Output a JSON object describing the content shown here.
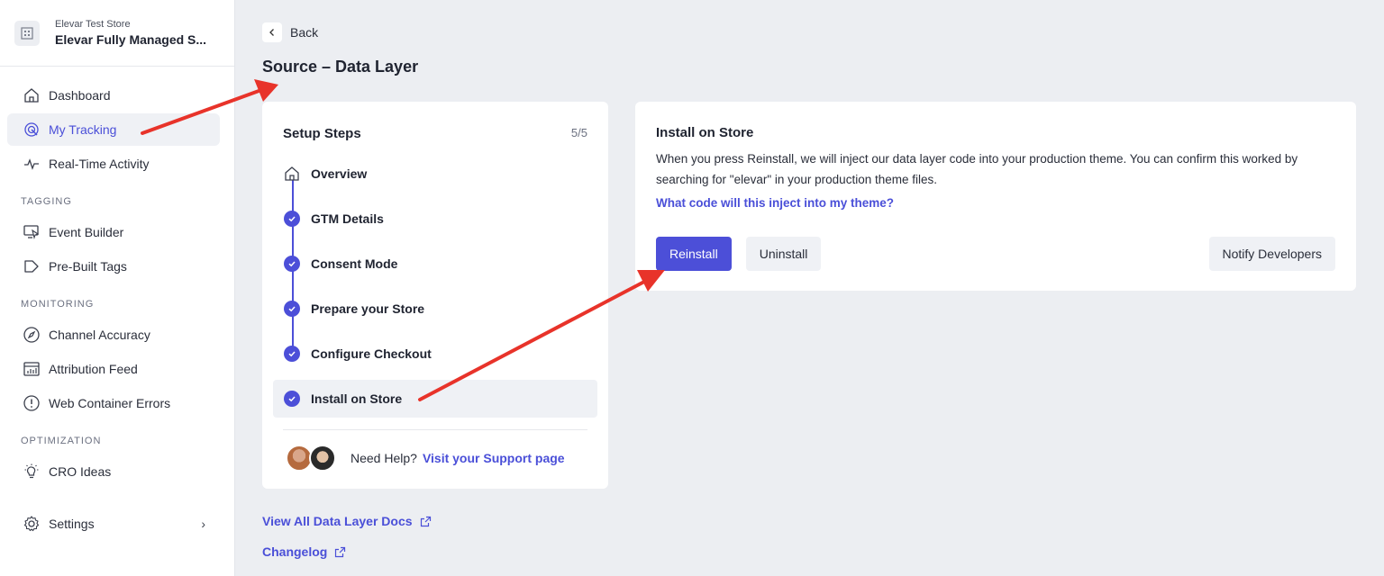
{
  "store": {
    "subtitle": "Elevar Test Store",
    "name": "Elevar Fully Managed S..."
  },
  "sidebar": {
    "top_items": [
      {
        "label": "Dashboard",
        "icon": "home-icon"
      },
      {
        "label": "My Tracking",
        "icon": "target-icon",
        "active": true
      },
      {
        "label": "Real-Time Activity",
        "icon": "pulse-icon"
      }
    ],
    "tagging": {
      "title": "TAGGING",
      "items": [
        {
          "label": "Event Builder",
          "icon": "monitor-cursor-icon"
        },
        {
          "label": "Pre-Built Tags",
          "icon": "tag-icon"
        }
      ]
    },
    "monitoring": {
      "title": "MONITORING",
      "items": [
        {
          "label": "Channel Accuracy",
          "icon": "compass-icon"
        },
        {
          "label": "Attribution Feed",
          "icon": "bar-chart-icon"
        },
        {
          "label": "Web Container Errors",
          "icon": "alert-circle-icon"
        }
      ]
    },
    "optimization": {
      "title": "OPTIMIZATION",
      "items": [
        {
          "label": "CRO Ideas",
          "icon": "lightbulb-icon"
        }
      ]
    },
    "settings": {
      "label": "Settings",
      "icon": "gear-icon"
    }
  },
  "header": {
    "back_label": "Back",
    "title": "Source – Data Layer"
  },
  "steps": {
    "title": "Setup Steps",
    "count": "5/5",
    "items": [
      {
        "label": "Overview",
        "icon": "home-icon"
      },
      {
        "label": "GTM Details",
        "done": true
      },
      {
        "label": "Consent Mode",
        "done": true
      },
      {
        "label": "Prepare your Store",
        "done": true
      },
      {
        "label": "Configure Checkout",
        "done": true
      },
      {
        "label": "Install on Store",
        "done": true,
        "selected": true
      }
    ],
    "help_text": "Need Help?",
    "help_link": "Visit your Support page"
  },
  "install": {
    "title": "Install on Store",
    "description": "When you press Reinstall, we will inject our data layer code into your production theme. You can confirm this worked by searching for \"elevar\" in your production theme files.",
    "link": "What code will this inject into my theme?",
    "reinstall_label": "Reinstall",
    "uninstall_label": "Uninstall",
    "notify_label": "Notify Developers"
  },
  "links": {
    "docs": "View All Data Layer Docs",
    "changelog": "Changelog"
  },
  "colors": {
    "accent": "#4c4fd8",
    "annotation": "#e8332a"
  }
}
